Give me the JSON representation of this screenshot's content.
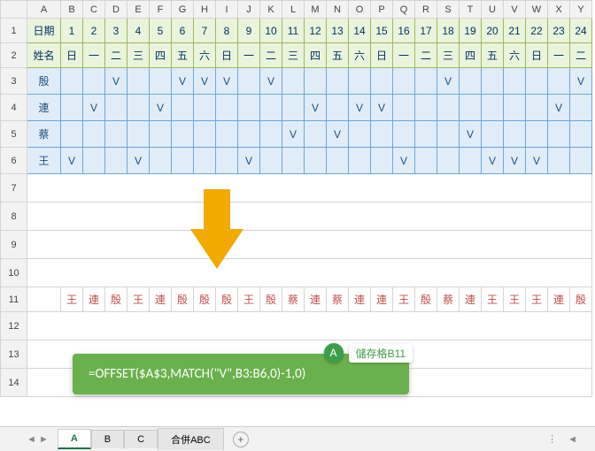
{
  "headers": {
    "row_labels": [
      "1",
      "2",
      "3",
      "4",
      "5",
      "6",
      "7",
      "8",
      "9",
      "10",
      "11",
      "12",
      "13",
      "14"
    ],
    "col_labels": [
      "A",
      "B",
      "C",
      "D",
      "E",
      "F",
      "G",
      "H",
      "I",
      "J",
      "K",
      "L",
      "M",
      "N",
      "O",
      "P",
      "Q",
      "R",
      "S",
      "T",
      "U",
      "V",
      "W",
      "X",
      "Y"
    ]
  },
  "row1": {
    "label": "日期",
    "values": [
      "1",
      "2",
      "3",
      "4",
      "5",
      "6",
      "7",
      "8",
      "9",
      "10",
      "11",
      "12",
      "13",
      "14",
      "15",
      "16",
      "17",
      "18",
      "19",
      "20",
      "21",
      "22",
      "23",
      "24"
    ]
  },
  "row2": {
    "label": "姓名",
    "values": [
      "日",
      "一",
      "二",
      "三",
      "四",
      "五",
      "六",
      "日",
      "一",
      "二",
      "三",
      "四",
      "五",
      "六",
      "日",
      "一",
      "二",
      "三",
      "四",
      "五",
      "六",
      "日",
      "一",
      "二"
    ]
  },
  "names": [
    "殷",
    "連",
    "蔡",
    "王"
  ],
  "marks": {
    "r3": [
      "",
      "",
      "V",
      "",
      "",
      "V",
      "V",
      "V",
      "",
      "V",
      "",
      "",
      "",
      "",
      "",
      "",
      "",
      "V",
      "",
      "",
      "",
      "",
      "",
      "V"
    ],
    "r4": [
      "",
      "V",
      "",
      "",
      "V",
      "",
      "",
      "",
      "",
      "",
      "",
      "V",
      "",
      "V",
      "V",
      "",
      "",
      "",
      "",
      "",
      "",
      "",
      "V",
      ""
    ],
    "r5": [
      "",
      "",
      "",
      "",
      "",
      "",
      "",
      "",
      "",
      "",
      "V",
      "",
      "V",
      "",
      "",
      "",
      "",
      "",
      "V",
      "",
      "",
      "",
      "",
      ""
    ],
    "r6": [
      "V",
      "",
      "",
      "V",
      "",
      "",
      "",
      "",
      "V",
      "",
      "",
      "",
      "",
      "",
      "",
      "V",
      "",
      "",
      "",
      "V",
      "V",
      "V",
      "",
      ""
    ]
  },
  "row11": [
    "王",
    "連",
    "殷",
    "王",
    "連",
    "殷",
    "殷",
    "殷",
    "王",
    "殷",
    "蔡",
    "連",
    "蔡",
    "連",
    "連",
    "王",
    "殷",
    "蔡",
    "連",
    "王",
    "王",
    "王",
    "連",
    "殷"
  ],
  "tooltip": {
    "badge_letter": "A",
    "badge_text": "儲存格B11",
    "formula": "=OFFSET($A$3,MATCH(\"V\",B3:B6,0)-1,0)"
  },
  "tabs": {
    "items": [
      "A",
      "B",
      "C",
      "合併ABC"
    ],
    "active": 0,
    "add": "+"
  },
  "chart_data": {
    "type": "table",
    "title": "Excel duty schedule lookup",
    "dates": [
      1,
      2,
      3,
      4,
      5,
      6,
      7,
      8,
      9,
      10,
      11,
      12,
      13,
      14,
      15,
      16,
      17,
      18,
      19,
      20,
      21,
      22,
      23,
      24
    ],
    "weekdays": [
      "日",
      "一",
      "二",
      "三",
      "四",
      "五",
      "六",
      "日",
      "一",
      "二",
      "三",
      "四",
      "五",
      "六",
      "日",
      "一",
      "二",
      "三",
      "四",
      "五",
      "六",
      "日",
      "一",
      "二"
    ],
    "people": [
      "殷",
      "連",
      "蔡",
      "王"
    ],
    "schedule": {
      "殷": [
        3,
        6,
        7,
        8,
        10,
        18,
        24
      ],
      "連": [
        2,
        5,
        12,
        14,
        15,
        23
      ],
      "蔡": [
        11,
        13,
        19
      ],
      "王": [
        1,
        4,
        9,
        16,
        20,
        21,
        22
      ]
    },
    "result_row": [
      "王",
      "連",
      "殷",
      "王",
      "連",
      "殷",
      "殷",
      "殷",
      "王",
      "殷",
      "蔡",
      "連",
      "蔡",
      "連",
      "連",
      "王",
      "殷",
      "蔡",
      "連",
      "王",
      "王",
      "王",
      "連",
      "殷"
    ],
    "formula": "=OFFSET($A$3,MATCH(\"V\",B3:B6,0)-1,0)"
  }
}
